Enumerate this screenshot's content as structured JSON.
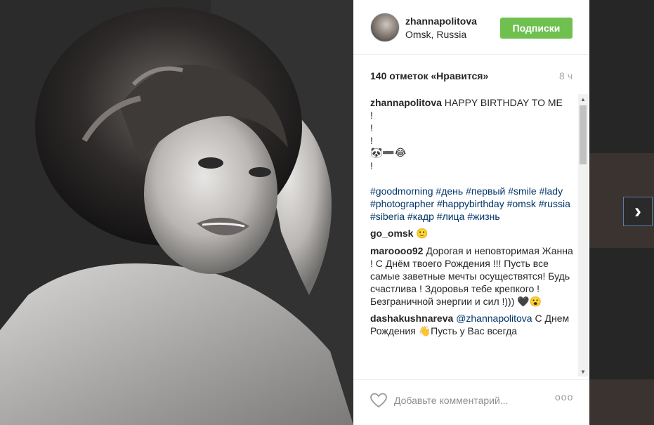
{
  "post": {
    "username": "zhannapolitova",
    "location": "Omsk, Russia",
    "follow_label": "Подписки",
    "likes": "140 отметок «Нравится»",
    "time_ago": "8 ч"
  },
  "caption": {
    "username": "zhannapolitova",
    "text": "HAPPY BIRTHDAY TO ME",
    "lines": [
      "!",
      "!",
      "!",
      "🐼➖😂",
      "!"
    ],
    "hashtags": [
      "#goodmorning",
      "#день",
      "#первый",
      "#smile",
      "#lady",
      "#photographer",
      "#happybirthday",
      "#omsk",
      "#russia",
      "#siberia",
      "#кадр",
      "#лица",
      "#жизнь"
    ]
  },
  "comments": [
    {
      "username": "go_omsk",
      "text": "🙂"
    },
    {
      "username": "maroooo92",
      "text": "Дорогая и неповторимая Жанна ! С Днём твоего Рождения !!! Пусть все самые заветные мечты осуществятся! Будь счастлива ! Здоровья тебе крепкого ! Безграничной энергии и сил !))) 🖤😮"
    },
    {
      "username": "dashakushnareva",
      "mention": "@zhannapolitova",
      "text": "С Днем Рождения 👋Пусть у Вас всегда"
    }
  ],
  "footer": {
    "comment_placeholder": "Добавьте комментарий...",
    "more_label": "ooo"
  },
  "icons": {
    "next": "chevron-right-icon",
    "like": "heart-icon",
    "more": "more-options-icon"
  },
  "colors": {
    "follow_button": "#70c050",
    "hashtag": "#003569",
    "time": "#a5a7aa"
  }
}
